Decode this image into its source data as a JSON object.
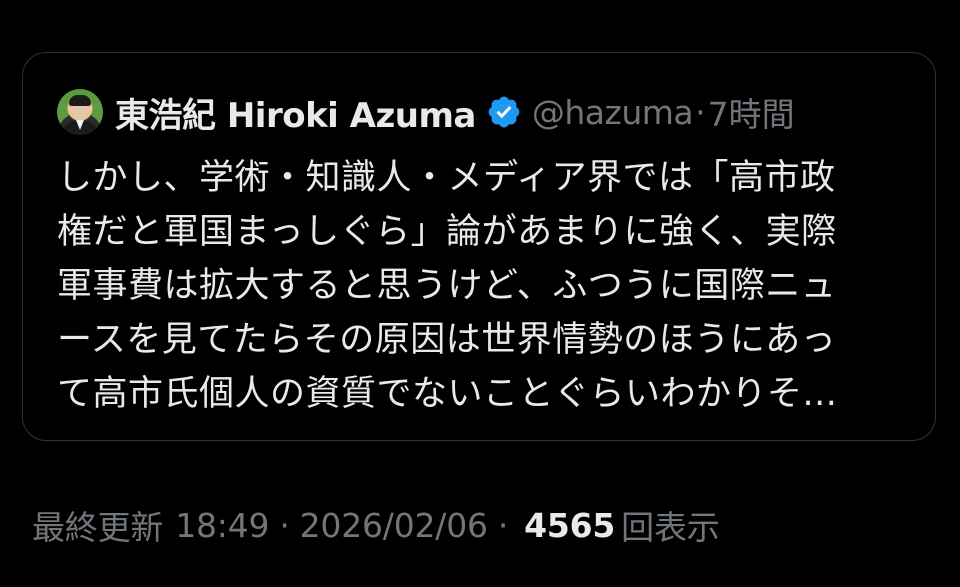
{
  "quote": {
    "author": {
      "display_name": "東浩紀 Hiroki Azuma",
      "handle": "@hazuma",
      "separator": "·",
      "relative_time": "7時間",
      "verified": true,
      "verified_color": "#1d9bf0"
    },
    "text_lines": [
      "しかし、学術・知識人・メディア界では「高市政",
      "権だと軍国まっしぐら」論があまりに強く、実際",
      "軍事費は拡大すると思うけど、ふつうに国際ニュ",
      "ースを見てたらその原因は世界情勢のほうにあっ",
      "て高市氏個人の資質でないことぐらいわかりそ..."
    ]
  },
  "footer": {
    "updated_label": "最終更新",
    "time": "18:49",
    "sep1": "·",
    "date": "2026/02/06",
    "sep2": "·",
    "view_count": "4565",
    "views_label": "回表示"
  },
  "colors": {
    "background": "#000000",
    "primary_text": "#e7e9ea",
    "secondary_text": "#71767b",
    "border": "#2f3336",
    "verified": "#1d9bf0"
  }
}
